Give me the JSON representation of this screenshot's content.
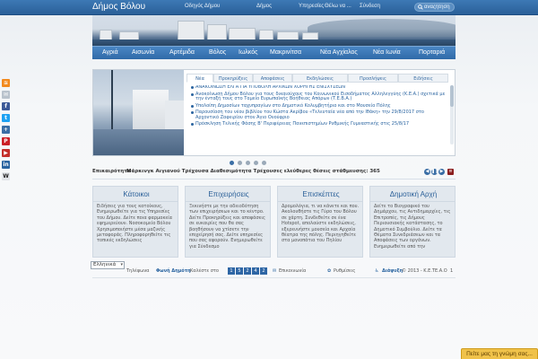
{
  "site": {
    "title": "Δήμος Βόλου"
  },
  "topnav": {
    "items": [
      "Οδηγός Δήμου",
      "Δήμος",
      "Υπηρεσίες",
      "Θέλω να ...",
      "Σύνδεση"
    ]
  },
  "search": {
    "placeholder": "αναζήτηση"
  },
  "menu": {
    "items": [
      "Αγριά",
      "Αισωνία",
      "Αρτέμιδα",
      "Βόλος",
      "Ιωλκός",
      "Μακρινίτσα",
      "Νέα Αγχίαλος",
      "Νέα Ιωνία",
      "Πορταριά"
    ]
  },
  "slider": {
    "tabs": [
      "Νέα",
      "Προκηρύξεις",
      "Αποφάσεις",
      "Εκδηλώσεις",
      "Πρoσλήψεις",
      "Ειδήσεις"
    ],
    "active_tab": "Νέα",
    "news": [
      "ΑΝΑΚΟΙΝΩΣΗ ΕΛΓΑ ΓΙΑ ΥΠΟΒΟΛΗ ΑΡΧΙΚΩΝ ΧΟΡΗΓΗΣ ΕΝΙΣΧΥΣΕΩΝ",
      "Ανακοίνωση Δήμου Βόλου για τους δικαιούχους του Κοινωνικού Εισοδήματος Αλληλεγγύης (Κ.Ε.Α.) σχετικά με την ένταξή τους στο Ταμείο Ευρωπαϊκής Βοήθειας Απόρων (Τ.Ε.Β.Α.)",
      "Υπολοίπη Δημοσίων ταχυπραγίων στο Δημοτικό Κολυμβητήριο και στο Μουσείο Πόλης",
      "Παρουσίαση του νέου βιβλίου του Κώστα Ακρίβου «Τελευταία νέα από την Ιθάκη» την 29/8/2017 στο Αρχοντικό Ζαφειρίου στον Άγιο Ονούφριο",
      "Πρόσκληση Τελικής Φάσης Β' Περιφέρειας Πανεπιστημίων Ρυθμικής Γυμναστικής στις 25/8/17"
    ],
    "dots": 5,
    "active_dot": 1
  },
  "ticker": {
    "label": "Επικαιρότητα",
    "text": "Μάρκινγκ Αιγιανού Τρέχουσα Διαθεσιμότητα Τρέχουσες ελεύθερες θέσεις στάθμευσης: 365"
  },
  "columns": [
    {
      "title": "Κάτοικοι",
      "body": "Ειδήσεις για τους κατοίκους, Ενημερωθείτε για τις Υπηρεσίες του Δήμου. Δείτε ποια φαρμακεία εφημερεύουν. Νοσοκομείο Βόλου Χρησιμοποιήστε μέσα μαζικής μεταφοράς. Πληροφορηθείτε τις τοπικές εκδηλώσεις"
    },
    {
      "title": "Επιχειρήσεις",
      "body": "Ξεκινήστε με την αδειοδότηση των επιχειρήσεων και το κέντρο. Δείτε Προκηρύξεις και αποφάσεις σε ευκαιρίες που θα σας βοηθήσουν να χτίσετε την επιχείρησή σας. Δείτε υπηρεσίες που σας αφορούν. Ενημερωθείτε για Σύνδεσμο"
    },
    {
      "title": "Επισκέπτες",
      "body": "Δρομολόγια, τι να κάνετε και που. Ακολουθήστε τις Γύρο του Βόλου σε χάρτη. Συνδεθείτε σε ένα Hotspot, απολαύστε εκδηλώσεις, εξερευνήστε μουσεία και Αρχαία θέατρα της πόλης. Περιηγηθείτε στα μονοπάτια του Πηλίου"
    },
    {
      "title": "Δημοτική Αρχή",
      "body": "Δείτε το Βιογραφικό του Δημάρχου, τις Αντιδημαρχίες, τις Επιτροπές, τις Δήμους Περιουσιακής κατάστασης, το Δημοτικό Συμβούλιο. Δείτε τα Θέματα Συνεδριάσεων και τα Αποφάσεις των οργάνων. Ενημερωθείτε από την"
    }
  ],
  "language": {
    "selected": "Ελληνικά"
  },
  "footer": {
    "phonebook": "Τηλέφωνα",
    "voice_label": "Φωνή Δημότη",
    "voice_text": "Καλέστε στο",
    "voice_pages": [
      "1",
      "5",
      "2",
      "4",
      "2"
    ],
    "contact": "Επικοινωνία",
    "settings": "Ρυθμίσεις",
    "accessibility": "Διάψυξη",
    "copyright": "© 2013 - Κ.Ε.ΤΕ.Α.Ο",
    "number": "1"
  },
  "feedback": {
    "label": "Πείτε μας τη γνώμη σας..."
  },
  "colors": {
    "brand_blue": "#2f6aa8",
    "accent_orange": "#f0c24a"
  }
}
